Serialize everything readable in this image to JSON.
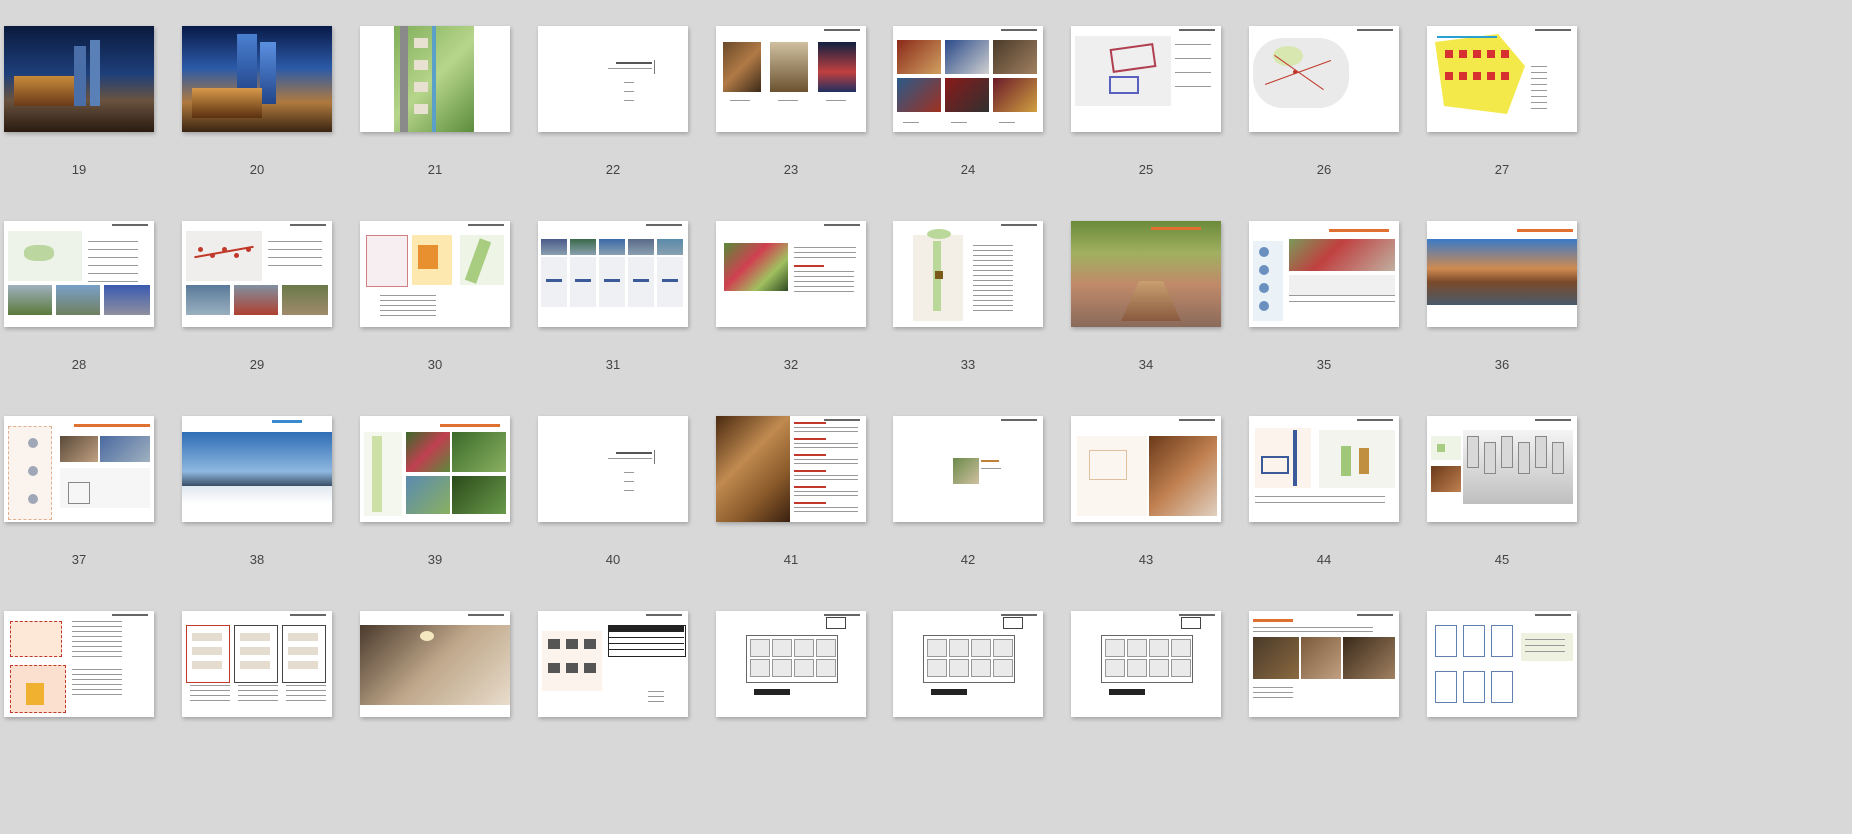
{
  "slide_sorter": {
    "slides": [
      {
        "num": "19",
        "kind": "photo-night-building"
      },
      {
        "num": "20",
        "kind": "photo-night-tower"
      },
      {
        "num": "21",
        "kind": "site-plan-green"
      },
      {
        "num": "22",
        "kind": "section-title"
      },
      {
        "num": "23",
        "kind": "three-photos"
      },
      {
        "num": "24",
        "kind": "photo-grid"
      },
      {
        "num": "25",
        "kind": "map-lines"
      },
      {
        "num": "26",
        "kind": "map-red"
      },
      {
        "num": "27",
        "kind": "map-colored"
      },
      {
        "num": "28",
        "kind": "map-with-photos"
      },
      {
        "num": "29",
        "kind": "map-with-photos-red"
      },
      {
        "num": "30",
        "kind": "three-diagrams"
      },
      {
        "num": "31",
        "kind": "five-columns"
      },
      {
        "num": "32",
        "kind": "photo-with-text"
      },
      {
        "num": "33",
        "kind": "plan-with-text"
      },
      {
        "num": "34",
        "kind": "street-rendering"
      },
      {
        "num": "35",
        "kind": "plan-rendering-section"
      },
      {
        "num": "36",
        "kind": "canal-photo"
      },
      {
        "num": "37",
        "kind": "plan-photos-section"
      },
      {
        "num": "38",
        "kind": "skyline-photo"
      },
      {
        "num": "39",
        "kind": "plan-and-garden"
      },
      {
        "num": "40",
        "kind": "section-title"
      },
      {
        "num": "41",
        "kind": "model-with-text"
      },
      {
        "num": "42",
        "kind": "small-image-title"
      },
      {
        "num": "43",
        "kind": "plan-and-model"
      },
      {
        "num": "44",
        "kind": "plan-diagram"
      },
      {
        "num": "45",
        "kind": "plan-and-perspective"
      },
      {
        "num": "",
        "kind": "plan-red-text"
      },
      {
        "num": "",
        "kind": "three-unit-plans"
      },
      {
        "num": "",
        "kind": "interior-photo"
      },
      {
        "num": "",
        "kind": "plan-with-table"
      },
      {
        "num": "",
        "kind": "floor-plan"
      },
      {
        "num": "",
        "kind": "floor-plan"
      },
      {
        "num": "",
        "kind": "floor-plan"
      },
      {
        "num": "",
        "kind": "photos-orange-text"
      },
      {
        "num": "",
        "kind": "unit-plans-grid"
      }
    ]
  }
}
